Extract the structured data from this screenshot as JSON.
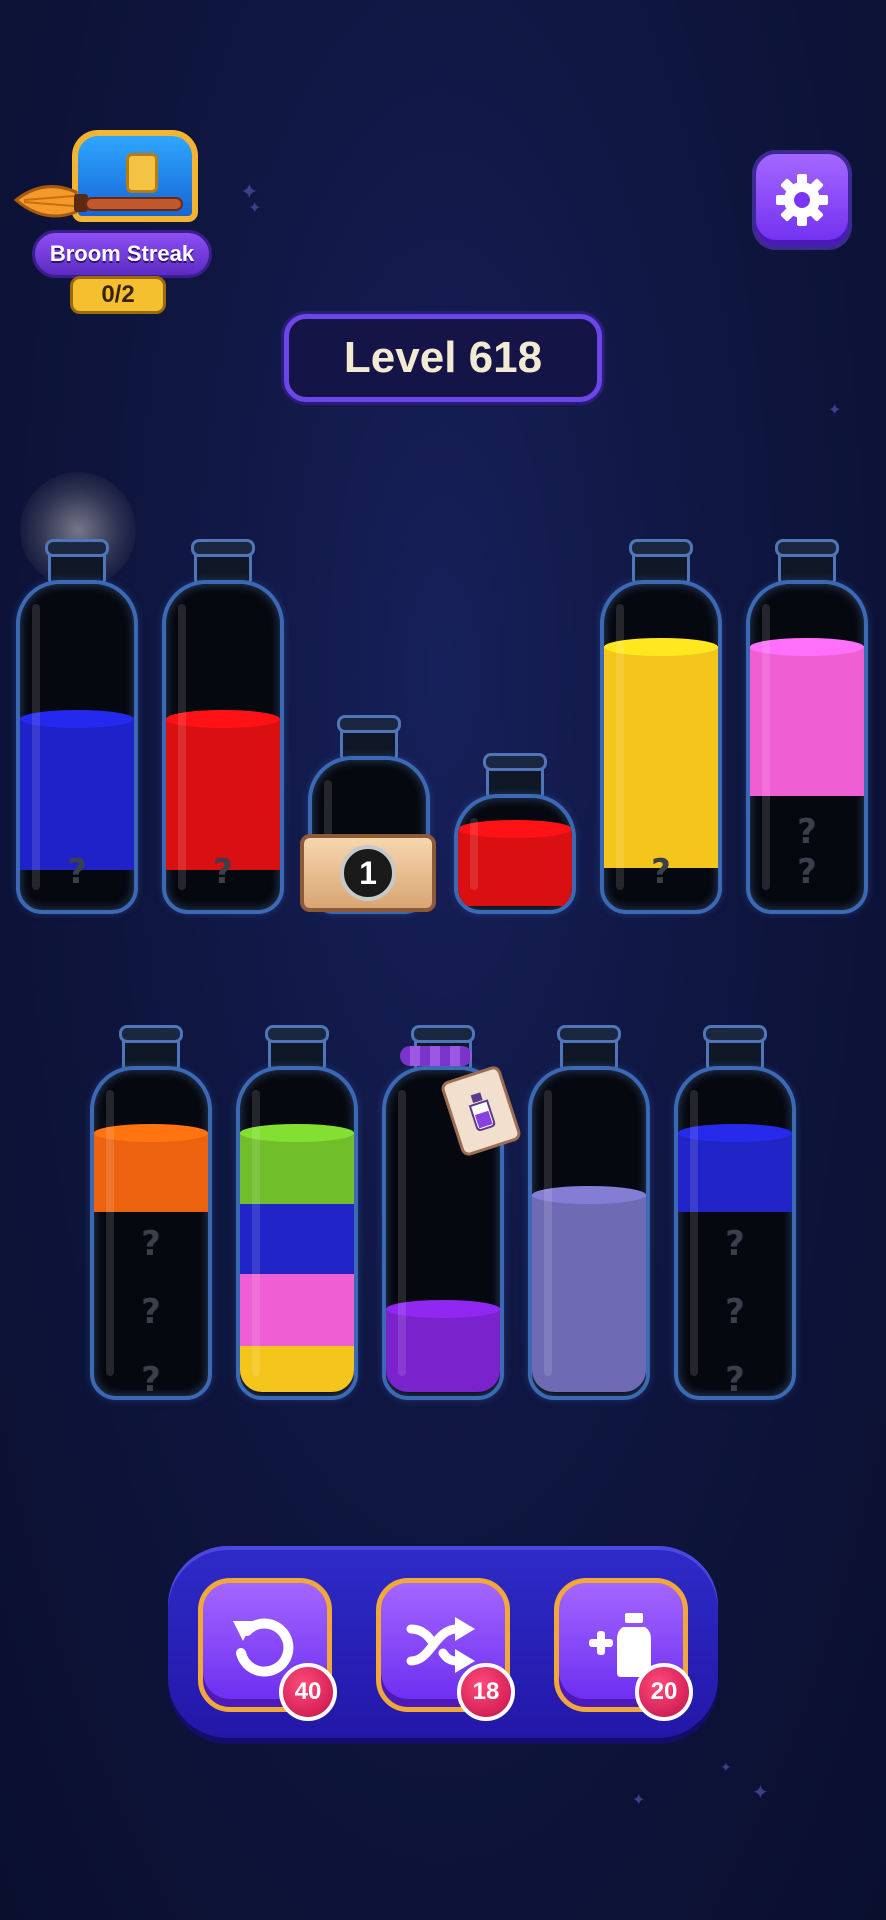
{
  "streak": {
    "label": "Broom Streak",
    "progress": "0/2"
  },
  "level": {
    "label": "Level 618"
  },
  "unknown_mark": "?",
  "locked_bottle": {
    "unlock_count": "1"
  },
  "colors": {
    "blue": "#1f22c9",
    "red": "#d90f12",
    "yellow": "#f4c51a",
    "pink": "#ef5ed3",
    "orange": "#ec620e",
    "green": "#6fbe2a",
    "purple": "#7a22cc",
    "lavender": "#6f6ab4",
    "blue2": "#2124c7"
  },
  "powerups": {
    "undo": {
      "count": "40",
      "icon": "undo-icon"
    },
    "shuffle": {
      "count": "18",
      "icon": "shuffle-icon"
    },
    "add_bottle": {
      "count": "20",
      "icon": "add-bottle-icon"
    }
  }
}
